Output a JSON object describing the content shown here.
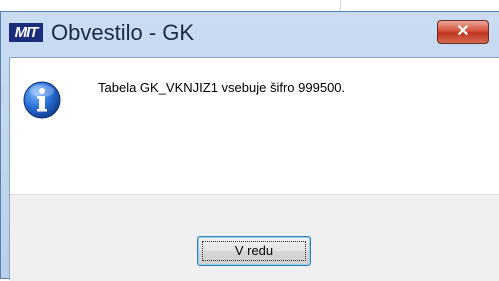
{
  "dialog": {
    "title": "Obvestilo - GK",
    "app_icon_text": "MIT",
    "close_label": "✕",
    "message": "Tabela GK_VKNJIZ1 vsebuje šifro 999500.",
    "icon": "info-icon",
    "ok_label": "V redu"
  },
  "colors": {
    "title_bar": "#c9dcf2",
    "close_button": "#c0351f",
    "footer": "#f0f0f0",
    "button_focus_border": "#3c7fb1"
  }
}
